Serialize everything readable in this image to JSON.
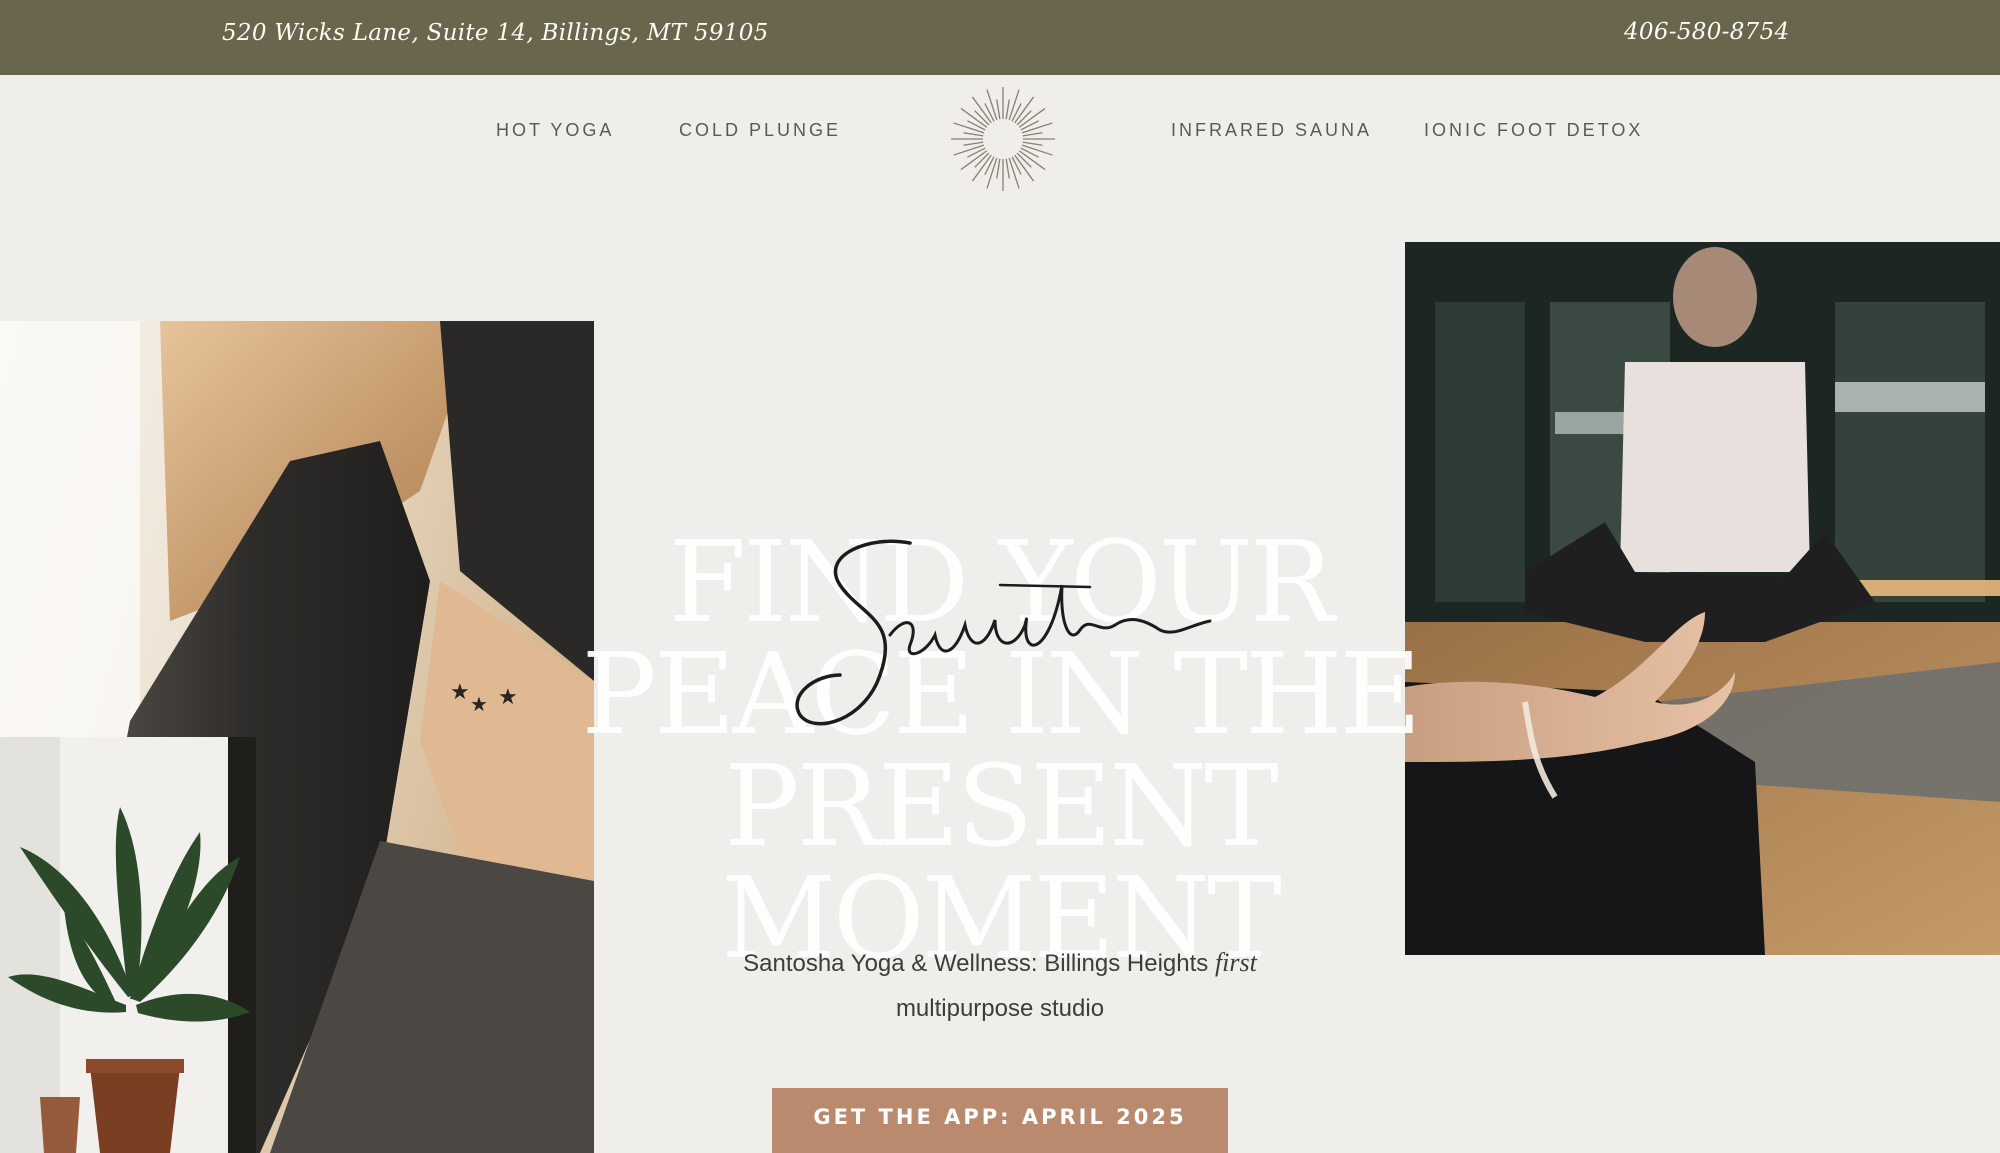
{
  "topbar": {
    "address": "520 Wicks Lane, Suite 14, Billings, MT 59105",
    "phone": "406-580-8754"
  },
  "nav": {
    "items": [
      {
        "label": "HOT YOGA"
      },
      {
        "label": "COLD PLUNGE"
      },
      {
        "label": "INFRARED SAUNA"
      },
      {
        "label": "IONIC FOOT DETOX"
      }
    ],
    "logo_icon": "sunburst-icon"
  },
  "hero": {
    "headline_lines": [
      "FIND YOUR",
      "PEACE IN THE",
      "PRESENT",
      "MOMENT"
    ],
    "script_overlay": "Santosha",
    "subtitle_before": "Santosha Yoga & Wellness: Billings Heights ",
    "subtitle_em": "first",
    "subtitle_after": "multipurpose studio",
    "cta_label": "GET THE APP: APRIL 2025"
  },
  "colors": {
    "topbar_bg": "#69664d",
    "page_bg": "#efeeea",
    "cta_bg": "#b98a6d"
  }
}
